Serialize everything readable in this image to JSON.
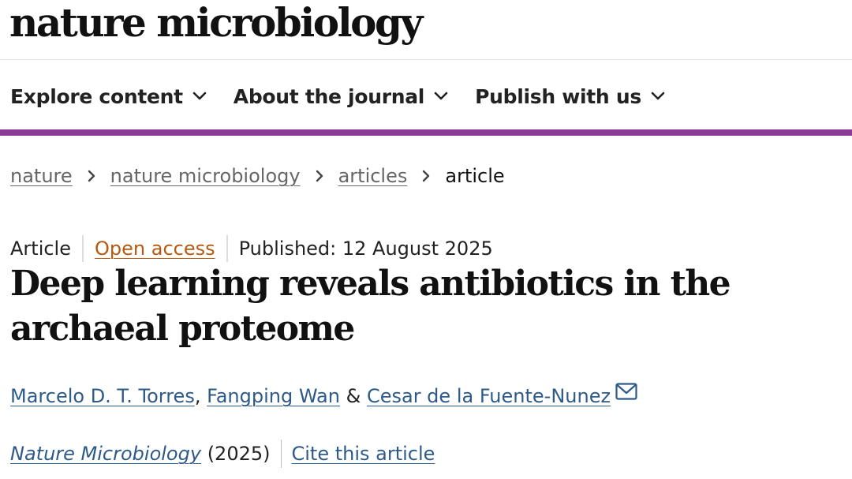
{
  "site": {
    "logo_text": "nature microbiology"
  },
  "nav": {
    "items": [
      {
        "label": "Explore content",
        "icon": "chevron-down-icon"
      },
      {
        "label": "About the journal",
        "icon": "chevron-down-icon"
      },
      {
        "label": "Publish with us",
        "icon": "chevron-down-icon"
      }
    ]
  },
  "breadcrumb": {
    "items": [
      {
        "label": "nature",
        "link": true
      },
      {
        "label": "nature microbiology",
        "link": true
      },
      {
        "label": "articles",
        "link": true
      },
      {
        "label": "article",
        "link": false
      }
    ],
    "separator_icon": "chevron-right-icon"
  },
  "article": {
    "type": "Article",
    "access": "Open access",
    "published": "Published: 12 August 2025",
    "title": "Deep learning reveals antibiotics in the archaeal proteome",
    "authors": {
      "first": "Marcelo D. T. Torres",
      "comma": ",",
      "second": "Fangping Wan",
      "ampersand": "&",
      "third": "Cesar de la Fuente-Nunez",
      "contact_icon": "mail-icon"
    },
    "journal": "Nature Microbiology",
    "year": "(2025)",
    "cite_label": "Cite this article"
  },
  "colors": {
    "brand_purple": "#8b3b97",
    "link_blue": "#2e5a8a",
    "open_access_orange": "#b8590f",
    "breadcrumb_grey": "#666666"
  }
}
